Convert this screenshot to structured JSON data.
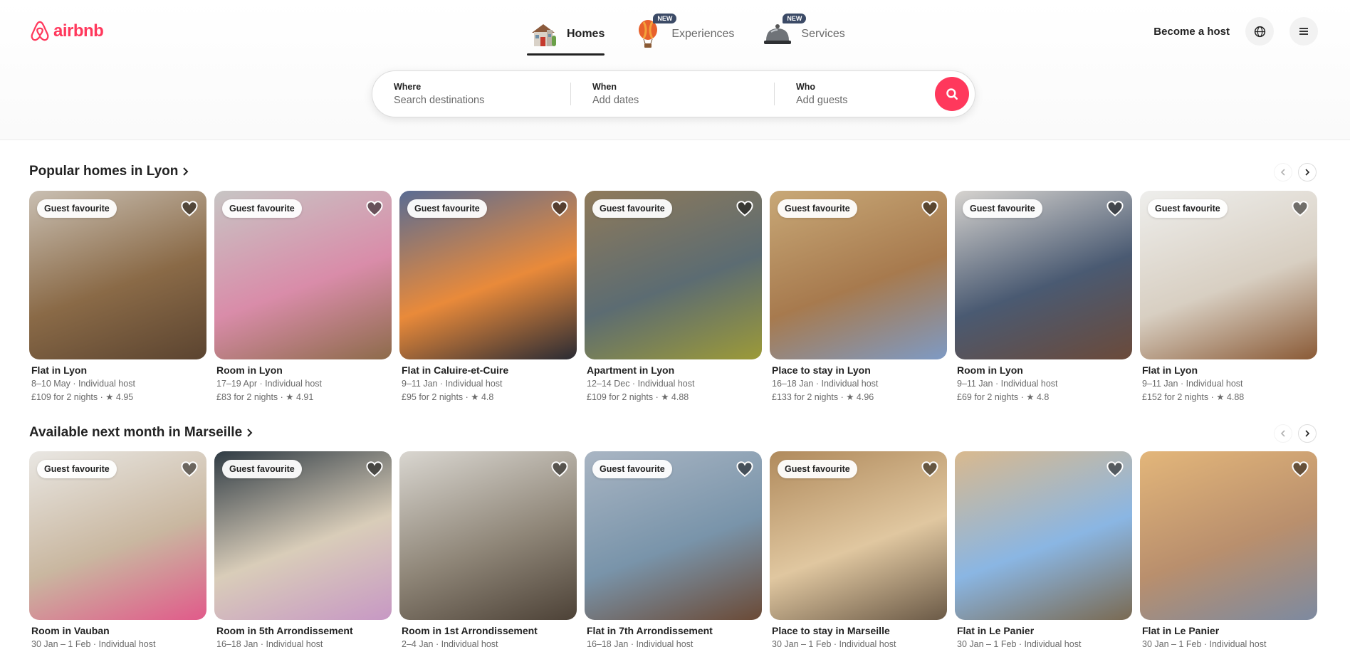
{
  "brand": {
    "name": "airbnb",
    "color": "#ff385c"
  },
  "nav": {
    "tabs": [
      {
        "label": "Homes",
        "icon": "house-icon",
        "active": true,
        "badge": ""
      },
      {
        "label": "Experiences",
        "icon": "hot-air-balloon-icon",
        "active": false,
        "badge": "NEW"
      },
      {
        "label": "Services",
        "icon": "service-bell-icon",
        "active": false,
        "badge": "NEW"
      }
    ]
  },
  "header": {
    "become_host": "Become a host"
  },
  "search": {
    "where_label": "Where",
    "where_placeholder": "Search destinations",
    "when_label": "When",
    "when_value": "Add dates",
    "who_label": "Who",
    "who_value": "Add guests"
  },
  "sections": [
    {
      "title": "Popular homes in Lyon",
      "cards": [
        {
          "badge": "Guest favourite",
          "title": "Flat in Lyon",
          "line1": "8–10 May · Individual host",
          "line2": "£109 for 2 nights · ★ 4.95",
          "colors": [
            "#c9bfb2",
            "#8a6a47",
            "#5b4430"
          ]
        },
        {
          "badge": "Guest favourite",
          "title": "Room in Lyon",
          "line1": "17–19 Apr · Individual host",
          "line2": "£83 for 2 nights · ★ 4.91",
          "colors": [
            "#c7c5c4",
            "#d98ca9",
            "#8d6b4a"
          ]
        },
        {
          "badge": "Guest favourite",
          "title": "Flat in Caluire-et-Cuire",
          "line1": "9–11 Jan · Individual host",
          "line2": "£95 for 2 nights · ★ 4.8",
          "colors": [
            "#5a6c93",
            "#e98a3a",
            "#2a2b34"
          ]
        },
        {
          "badge": "Guest favourite",
          "title": "Apartment in Lyon",
          "line1": "12–14 Dec · Individual host",
          "line2": "£109 for 2 nights · ★ 4.88",
          "colors": [
            "#8f7a5a",
            "#5c6c72",
            "#9c9a38"
          ]
        },
        {
          "badge": "Guest favourite",
          "title": "Place to stay in Lyon",
          "line1": "16–18 Jan · Individual host",
          "line2": "£133 for 2 nights · ★ 4.96",
          "colors": [
            "#c8a877",
            "#a77a4e",
            "#7e9ac4"
          ]
        },
        {
          "badge": "Guest favourite",
          "title": "Room in Lyon",
          "line1": "9–11 Jan · Individual host",
          "line2": "£69 for 2 nights · ★ 4.8",
          "colors": [
            "#d6d3cf",
            "#4a5a72",
            "#6b4a3a"
          ]
        },
        {
          "badge": "Guest favourite",
          "title": "Flat in Lyon",
          "line1": "9–11 Jan · Individual host",
          "line2": "£152 for 2 nights · ★ 4.88",
          "colors": [
            "#eeeeec",
            "#d8cfc2",
            "#8a5a36"
          ]
        }
      ]
    },
    {
      "title": "Available next month in Marseille",
      "cards": [
        {
          "badge": "Guest favourite",
          "title": "Room in Vauban",
          "line1": "30 Jan – 1 Feb · Individual host",
          "line2": "",
          "colors": [
            "#e9e7e3",
            "#c9b7a0",
            "#e15a8a"
          ]
        },
        {
          "badge": "Guest favourite",
          "title": "Room in 5th Arrondissement",
          "line1": "16–18 Jan · Individual host",
          "line2": "",
          "colors": [
            "#2f3b44",
            "#d9cdb9",
            "#c798c4"
          ]
        },
        {
          "badge": "",
          "title": "Room in 1st Arrondissement",
          "line1": "2–4 Jan · Individual host",
          "line2": "",
          "colors": [
            "#d9d6d0",
            "#8f8678",
            "#4d4237"
          ]
        },
        {
          "badge": "Guest favourite",
          "title": "Flat in 7th Arrondissement",
          "line1": "16–18 Jan · Individual host",
          "line2": "",
          "colors": [
            "#a9b5c3",
            "#7994aa",
            "#6b4a36"
          ]
        },
        {
          "badge": "Guest favourite",
          "title": "Place to stay in Marseille",
          "line1": "30 Jan – 1 Feb · Individual host",
          "line2": "",
          "colors": [
            "#b08a5c",
            "#e0c7a0",
            "#6b5a47"
          ]
        },
        {
          "badge": "",
          "title": "Flat in Le Panier",
          "line1": "30 Jan – 1 Feb · Individual host",
          "line2": "",
          "colors": [
            "#d9b98e",
            "#8ab6e3",
            "#7a6a52"
          ]
        },
        {
          "badge": "",
          "title": "Flat in Le Panier",
          "line1": "30 Jan – 1 Feb · Individual host",
          "line2": "",
          "colors": [
            "#e3b67a",
            "#b98f6d",
            "#7d8aa0"
          ]
        }
      ]
    }
  ]
}
